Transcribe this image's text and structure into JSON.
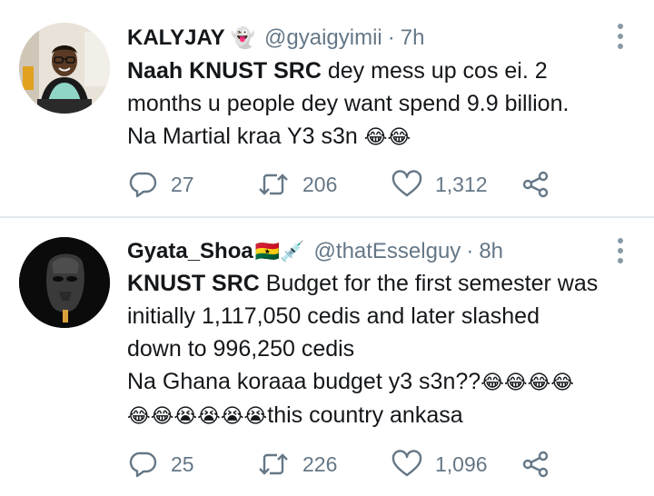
{
  "tweets": [
    {
      "name": "KALYJAY",
      "name_emoji": "👻",
      "handle": "@gyaigyimii",
      "separator": "·",
      "time": "7h",
      "lines": [
        {
          "bold": "Naah KNUST SRC",
          "text": " dey mess up cos ei. 2"
        },
        {
          "bold": "",
          "text": "months u people dey want spend 9.9 billion."
        },
        {
          "bold": "",
          "text": "Na Martial kraa Y3 s3n ",
          "emoji": "😂😂"
        }
      ],
      "replies": "27",
      "retweets": "206",
      "likes": "1,312"
    },
    {
      "name": "Gyata_Shoa",
      "name_emoji": "🇬🇭💉",
      "handle": "@thatEsselguy",
      "separator": "·",
      "time": "8h",
      "lines": [
        {
          "bold": "KNUST SRC",
          "text": " Budget for the first semester was"
        },
        {
          "bold": "",
          "text": "initially 1,117,050 cedis and later slashed"
        },
        {
          "bold": "",
          "text": "down to 996,250 cedis"
        },
        {
          "bold": "",
          "text": "Na Ghana koraaa budget y3 s3n??",
          "emoji": "😂😂😂😂"
        },
        {
          "bold": "",
          "text": "",
          "emoji": "😂😂😭😭😭😭",
          "after": "this country ankasa"
        }
      ],
      "replies": "25",
      "retweets": "226",
      "likes": "1,096"
    }
  ],
  "icons": {
    "reply": "reply-icon",
    "retweet": "retweet-icon",
    "like": "heart-icon",
    "share": "share-icon",
    "more": "more-vertical-icon"
  },
  "colors": {
    "text": "#14171a",
    "secondary": "#657786",
    "divider": "#e1e8ed"
  }
}
